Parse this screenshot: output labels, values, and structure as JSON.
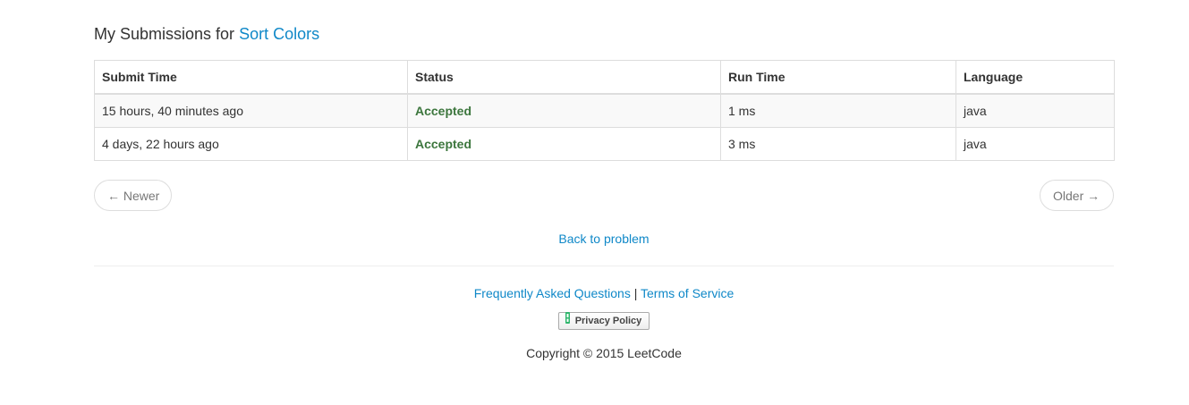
{
  "heading": {
    "prefix": "My Submissions for",
    "problem_link": "Sort Colors"
  },
  "table": {
    "columns": [
      "Submit Time",
      "Status",
      "Run Time",
      "Language"
    ],
    "rows": [
      {
        "submit_time": "15 hours, 40 minutes ago",
        "status": "Accepted",
        "run_time": "1 ms",
        "language": "java"
      },
      {
        "submit_time": "4 days, 22 hours ago",
        "status": "Accepted",
        "run_time": "3 ms",
        "language": "java"
      }
    ]
  },
  "pager": {
    "newer": "← Newer",
    "older": "Older →"
  },
  "back_link": "Back to problem",
  "footer": {
    "faq": "Frequently Asked Questions",
    "separator": "|",
    "terms": "Terms of Service",
    "privacy": "Privacy Policy",
    "copyright": "Copyright © 2015 LeetCode"
  },
  "colors": {
    "link": "#0f88c8",
    "accepted": "#3c763d",
    "privacy_icon": "#2fb66c"
  },
  "icons": {
    "privacy": "privacy-shield-icon"
  }
}
